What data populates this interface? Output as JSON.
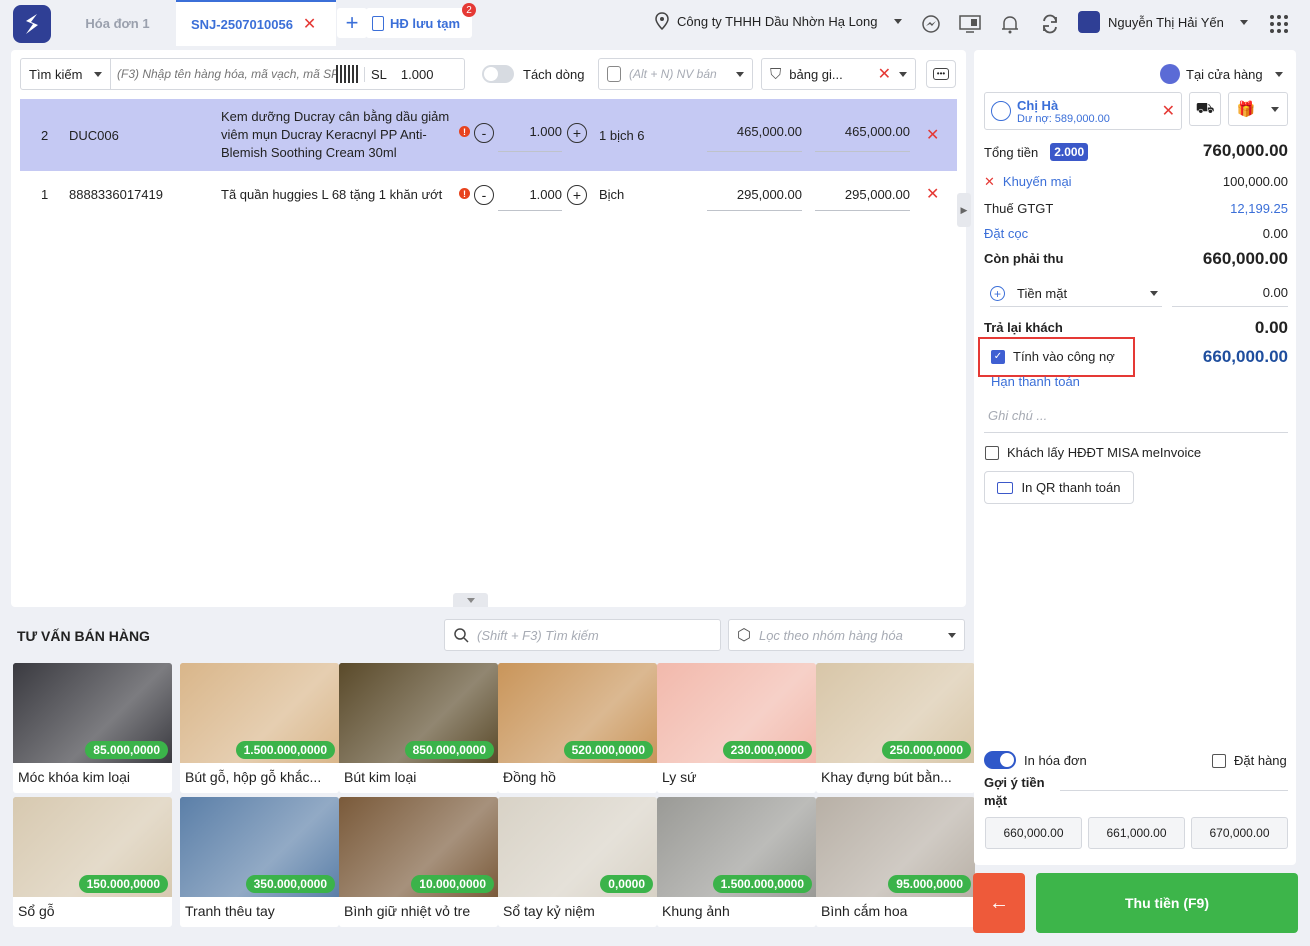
{
  "tabs": [
    {
      "label": "Hóa đơn 1"
    },
    {
      "label": "SNJ-2507010056"
    },
    {
      "label": "HĐ lưu tạm",
      "badge": "2"
    }
  ],
  "header": {
    "company": "Công ty THHH Dầu Nhờn Hạ Long",
    "user": "Nguyễn Thị Hải Yến"
  },
  "search": {
    "mode": "Tìm kiếm",
    "placeholder": "(F3) Nhập tên hàng hóa, mã vạch, mã SP",
    "qty_label": "SL",
    "qty_value": "1.000",
    "split_label": "Tách dòng",
    "staff_placeholder": "(Alt + N) NV bán",
    "pricelist": "bảng gi..."
  },
  "items": [
    {
      "no": "2",
      "code": "DUC006",
      "name": "Kem dưỡng Ducray cân bằng dầu giảm viêm mụn Ducray Keracnyl PP Anti-Blemish Soothing Cream 30ml",
      "qty": "1.000",
      "unit": "1 bịch 6",
      "price": "465,000.00",
      "total": "465,000.00"
    },
    {
      "no": "1",
      "code": "8888336017419",
      "name": "Tã quần huggies L 68 tặng 1 khăn ướt",
      "qty": "1.000",
      "unit": "Bịch",
      "price": "295,000.00",
      "total": "295,000.00"
    }
  ],
  "consult": {
    "title": "TƯ VẤN BÁN HÀNG",
    "search_placeholder": "(Shift + F3) Tìm kiếm",
    "filter_placeholder": "Lọc theo nhóm hàng hóa"
  },
  "products": [
    {
      "name": "Móc khóa kim loại",
      "price": "85.000,0000",
      "color": "#3a3a40"
    },
    {
      "name": "Bút gỗ, hộp gỗ khắc...",
      "price": "1.500.000,0000",
      "color": "#d9b68a"
    },
    {
      "name": "Bút kim loại",
      "price": "850.000,0000",
      "color": "#5a4a2a"
    },
    {
      "name": "Đồng hồ",
      "price": "520.000,0000",
      "color": "#c9955a"
    },
    {
      "name": "Ly sứ",
      "price": "230.000,0000",
      "color": "#f2b9ac"
    },
    {
      "name": "Khay đựng bút bằn...",
      "price": "250.000,0000",
      "color": "#d8c6a8"
    },
    {
      "name": "Sổ gỗ",
      "price": "150.000,0000",
      "color": "#d7c9b0"
    },
    {
      "name": "Tranh thêu tay",
      "price": "350.000,0000",
      "color": "#5b7fa8"
    },
    {
      "name": "Bình giữ nhiệt vỏ tre",
      "price": "10.000,0000",
      "color": "#7a5a3a"
    },
    {
      "name": "Sổ tay kỷ niệm",
      "price": "0,0000",
      "color": "#d8d2c6"
    },
    {
      "name": "Khung ảnh",
      "price": "1.500.000,0000",
      "color": "#9a9a96"
    },
    {
      "name": "Bình cắm hoa",
      "price": "95.000,0000",
      "color": "#b8b0a6"
    }
  ],
  "order": {
    "store": "Tại cửa hàng",
    "customer": "Chị Hà",
    "debt": "Dư nợ: 589,000.00",
    "total_label": "Tổng tiền",
    "total_qty": "2.000",
    "total": "760,000.00",
    "promo_label": "Khuyến mại",
    "promo": "100,000.00",
    "vat_label": "Thuế GTGT",
    "vat": "12,199.25",
    "deposit_label": "Đặt cọc",
    "deposit": "0.00",
    "due_label": "Còn phải thu",
    "due": "660,000.00",
    "method": "Tiền mặt",
    "method_amount": "0.00",
    "change_label": "Trả lại khách",
    "change": "0.00",
    "debt_check_label": "Tính vào công nợ",
    "debt_amount": "660,000.00",
    "due_date_label": "Hạn thanh toán",
    "note_placeholder": "Ghi chú ...",
    "einvoice_label": "Khách lấy HĐĐT MISA meInvoice",
    "qr_label": "In QR thanh toán",
    "print_invoice_label": "In hóa đơn",
    "preorder_label": "Đặt hàng",
    "suggest_label": "Gợi ý tiền mặt",
    "suggestions": [
      "660,000.00",
      "661,000.00",
      "670,000.00"
    ],
    "pay_label": "Thu tiền (F9)"
  },
  "colors": {
    "accent": "#3b6fd8",
    "pay": "#3db54a",
    "back": "#ee5a3a",
    "selected_row": "#c5c9f3"
  }
}
